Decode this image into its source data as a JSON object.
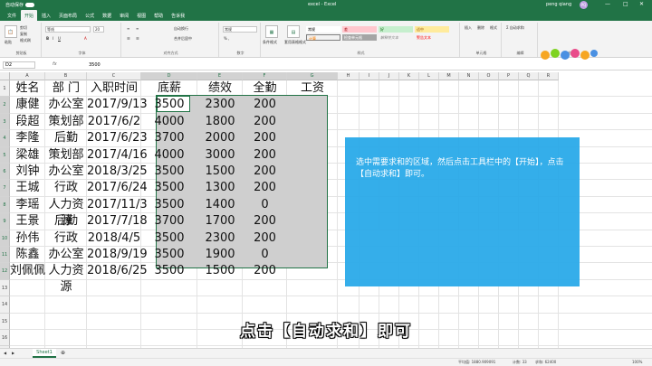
{
  "titlebar": {
    "autosave": "自动保存",
    "title": "excel - Excel",
    "user": "peng qiang",
    "avatar": "PQ",
    "min": "—",
    "max": "□",
    "close": "✕"
  },
  "tabs": [
    "文件",
    "开始",
    "插入",
    "页面布局",
    "公式",
    "数据",
    "审阅",
    "视图",
    "帮助",
    "告诉我"
  ],
  "ribbon": {
    "paste": "粘贴",
    "cut": "剪切",
    "copy": "复制",
    "painter": "格式刷",
    "clipboard_label": "剪贴板",
    "font_name": "等线",
    "font_size": "20",
    "font_label": "字体",
    "wrap": "自动换行",
    "merge": "合并后居中",
    "align_label": "对齐方式",
    "number_format": "常规",
    "number_label": "数字",
    "cond_format": "条件格式",
    "table_format": "套用表格格式",
    "styles": [
      "常规",
      "差",
      "好",
      "适中",
      "计算",
      "检查单元格",
      "解释性文本",
      "警告文本"
    ],
    "styles_label": "样式",
    "cells_label": "单元格",
    "insert": "插入",
    "delete": "删除",
    "format": "格式",
    "autosum": "自动求和",
    "edit_label": "编辑",
    "create_label": "创建"
  },
  "formula_bar": {
    "namebox": "D2",
    "fx": "fx",
    "value": "3500"
  },
  "columns": [
    "A",
    "B",
    "C",
    "D",
    "E",
    "F",
    "G",
    "H",
    "I",
    "J",
    "K",
    "L",
    "M",
    "N",
    "O",
    "P",
    "Q",
    "R"
  ],
  "rows": [
    "1",
    "2",
    "3",
    "4",
    "5",
    "6",
    "7",
    "8",
    "9",
    "10",
    "11",
    "12",
    "13",
    "14",
    "15",
    "16",
    "17"
  ],
  "table": {
    "headers": [
      "姓名",
      "部 门",
      "入职时间",
      "底薪",
      "绩效",
      "全勤",
      "工资"
    ],
    "rows": [
      [
        "康健",
        "办公室",
        "2017/9/13",
        "3500",
        "2300",
        "200",
        ""
      ],
      [
        "段超",
        "策划部",
        "2017/6/2",
        "4000",
        "1800",
        "200",
        ""
      ],
      [
        "李隆",
        "后勤",
        "2017/6/23",
        "3700",
        "2000",
        "200",
        ""
      ],
      [
        "梁雄",
        "策划部",
        "2017/4/16",
        "4000",
        "3000",
        "200",
        ""
      ],
      [
        "刘钟",
        "办公室",
        "2018/3/25",
        "3500",
        "1500",
        "200",
        ""
      ],
      [
        "王城",
        "行政",
        "2017/6/24",
        "3500",
        "1300",
        "200",
        ""
      ],
      [
        "李瑶",
        "人力资源",
        "2017/11/3",
        "3500",
        "1400",
        "0",
        ""
      ],
      [
        "王景",
        "后勤",
        "2017/7/18",
        "3700",
        "1700",
        "200",
        ""
      ],
      [
        "孙伟",
        "行政",
        "2018/4/5",
        "3500",
        "2300",
        "200",
        ""
      ],
      [
        "陈鑫",
        "办公室",
        "2018/9/19",
        "3500",
        "1900",
        "0",
        ""
      ],
      [
        "刘佩佩",
        "人力资源",
        "2018/6/25",
        "3500",
        "1500",
        "200",
        ""
      ]
    ]
  },
  "callout": "选中需要求和的区域，然后点击工具栏中的【开始】，点击【自动求和】即可。",
  "subtitle": "点击【自动求和】即可",
  "sheet_tab": "Sheet1",
  "status": {
    "avg": "平均值: 1880.909091",
    "count": "计数: 33",
    "sum": "求和: 62400",
    "zoom": "100%"
  },
  "colors": {
    "excel_green": "#217346",
    "callout_blue": "#2aaae9"
  }
}
